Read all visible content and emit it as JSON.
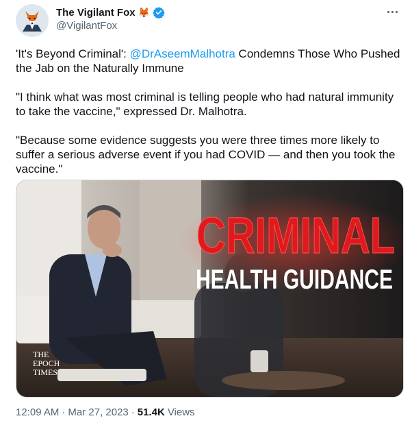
{
  "author": {
    "display_name": "The Vigilant Fox",
    "name_emoji": "🦊",
    "handle": "@VigilantFox",
    "verified": true,
    "avatar_icon": "fox-avatar-icon"
  },
  "menu_icon": "more-options-icon",
  "tweet": {
    "line1_prefix": "'It's Beyond Criminal': ",
    "line1_mention": "@DrAseemMalhotra",
    "line1_suffix": " Condemns Those Who Pushed the Jab on the Naturally Immune",
    "paragraph2": "\"I think what was most criminal is telling people who had natural immunity to take the vaccine,\" expressed Dr. Malhotra.",
    "paragraph3": "\"Because some evidence suggests you were three times more likely to suffer a serious adverse event if you had COVID — and then you took the vaccine.\""
  },
  "media": {
    "headline": "CRIMINAL",
    "subheadline": "HEALTH GUIDANCE",
    "logo_line1": "THE",
    "logo_line2": "EPOCH",
    "logo_line3": "TIMES"
  },
  "footer": {
    "time": "12:09 AM",
    "separator": "·",
    "date": "Mar 27, 2023",
    "views_count": "51.4K",
    "views_label": "Views"
  },
  "colors": {
    "link": "#1d9bf0",
    "muted": "#536471",
    "headline_red": "#e0191f"
  }
}
